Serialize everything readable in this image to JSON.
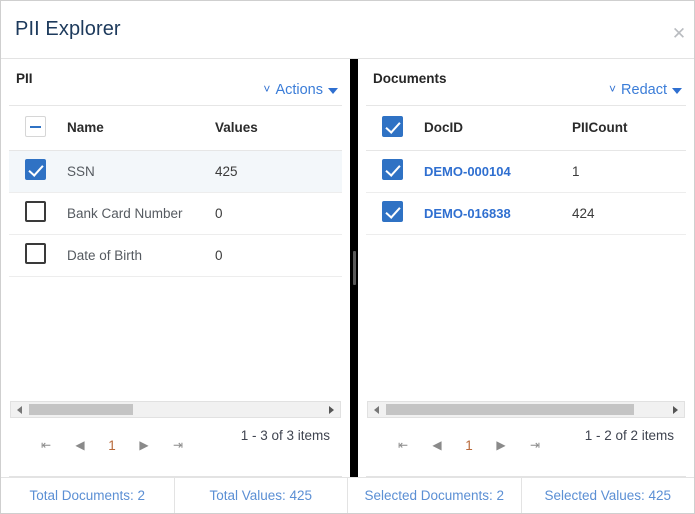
{
  "dialog": {
    "title": "PII Explorer",
    "close_icon": "close-icon"
  },
  "pii_panel": {
    "title": "PII",
    "menu": {
      "label": "Actions",
      "pre_icon": "chevron-down-icon",
      "post_icon": "caret-down-icon"
    },
    "columns": [
      "Name",
      "Values"
    ],
    "header_checkbox_state": "indeterminate",
    "rows": [
      {
        "checked": true,
        "name": "SSN",
        "values": "425"
      },
      {
        "checked": false,
        "name": "Bank Card Number",
        "values": "0"
      },
      {
        "checked": false,
        "name": "Date of Birth",
        "values": "0"
      }
    ],
    "pager": {
      "first_icon": "first-page-icon",
      "prev_icon": "previous-page-icon",
      "page": "1",
      "next_icon": "next-page-icon",
      "last_icon": "last-page-icon",
      "info": "1 - 3 of 3 items"
    },
    "scrollbar": {
      "left_icon": "scroll-left-icon",
      "right_icon": "scroll-right-icon",
      "thumb_percent": 35
    }
  },
  "documents_panel": {
    "title": "Documents",
    "menu": {
      "label": "Redact",
      "pre_icon": "chevron-down-icon",
      "post_icon": "caret-down-icon"
    },
    "columns": [
      "DocID",
      "PIICount"
    ],
    "header_checkbox_state": "checked",
    "rows": [
      {
        "checked": true,
        "doc_id": "DEMO-000104",
        "pii_count": "1"
      },
      {
        "checked": true,
        "doc_id": "DEMO-016838",
        "pii_count": "424"
      }
    ],
    "pager": {
      "first_icon": "first-page-icon",
      "prev_icon": "previous-page-icon",
      "page": "1",
      "next_icon": "next-page-icon",
      "last_icon": "last-page-icon",
      "info": "1 - 2 of 2 items"
    },
    "scrollbar": {
      "left_icon": "scroll-left-icon",
      "right_icon": "scroll-right-icon",
      "thumb_percent": 87
    }
  },
  "statusbar": {
    "items": [
      "Total Documents: 2",
      "Total Values: 425",
      "Selected Documents: 2",
      "Selected Values: 425"
    ]
  },
  "colors": {
    "link": "#2f6fd0",
    "status_text": "#5b8fd4",
    "checkbox_blue": "#2f72c4",
    "title": "#1d3a5c",
    "selected_row": "#f3f7fa",
    "splitter": "#000000"
  }
}
